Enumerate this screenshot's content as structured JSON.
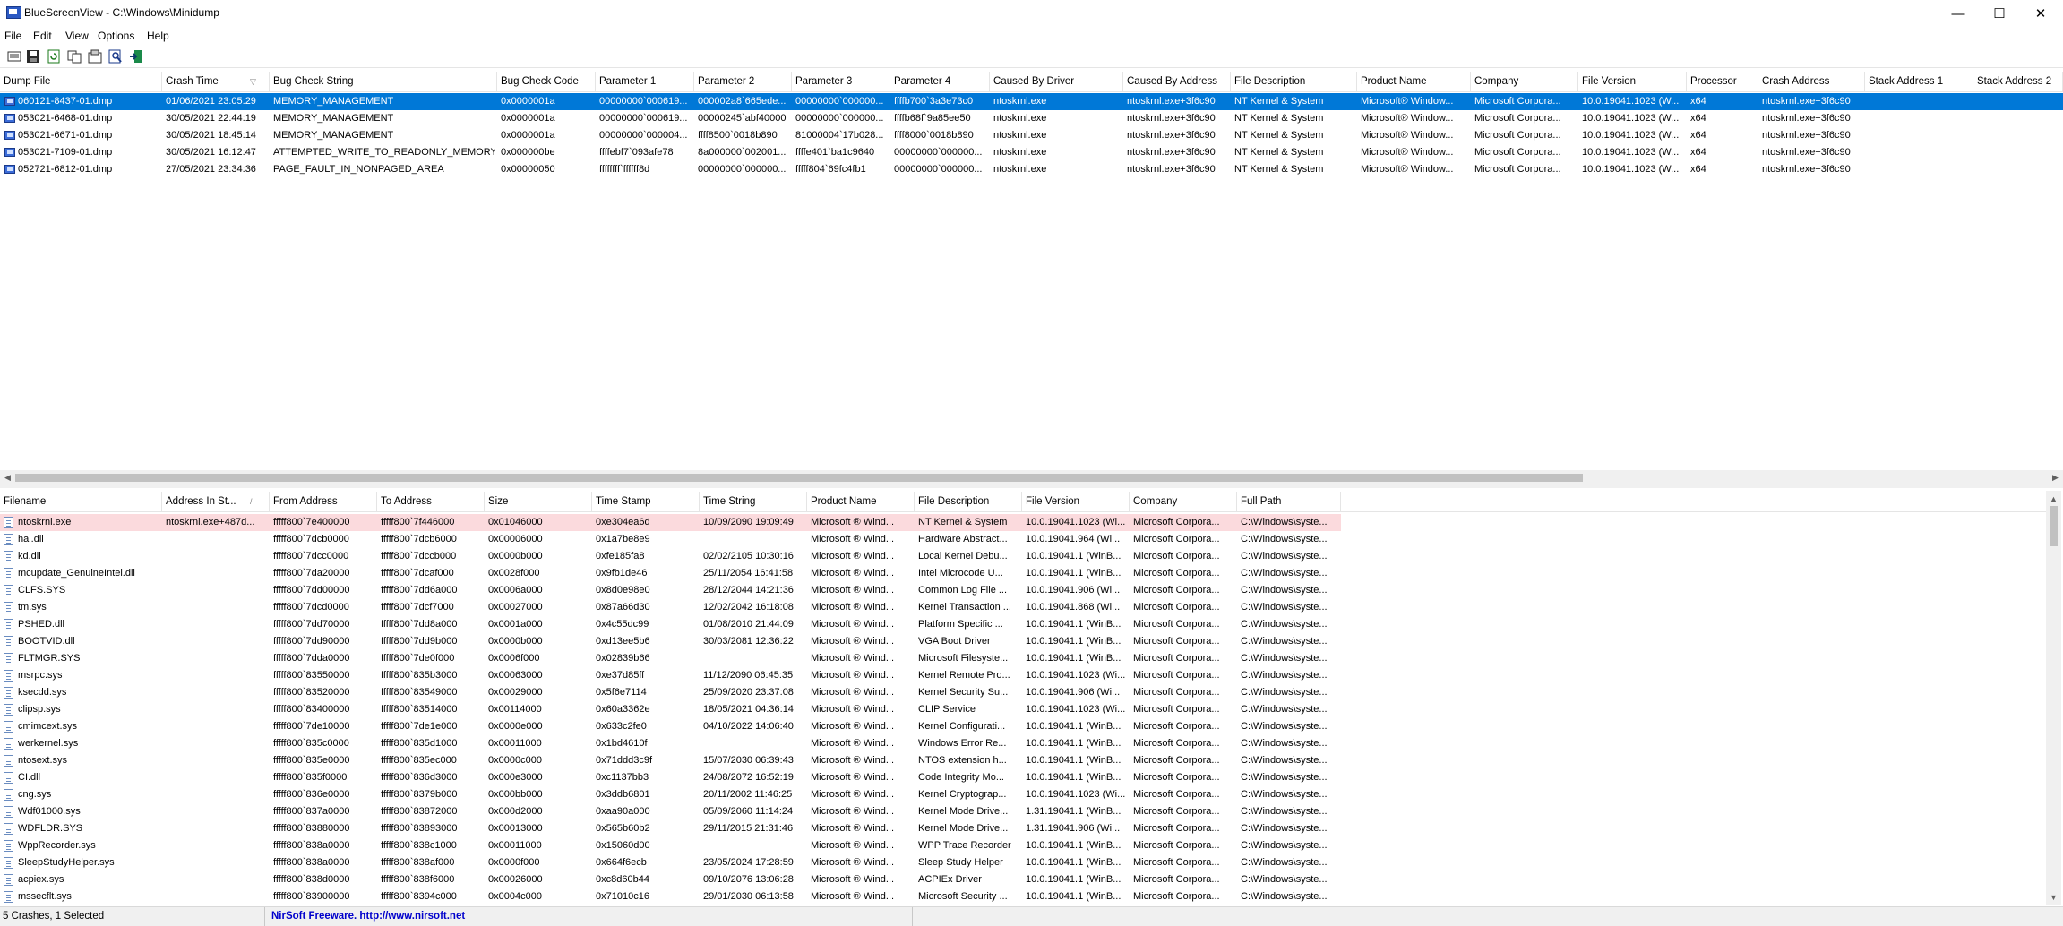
{
  "window": {
    "title": "BlueScreenView  -  C:\\Windows\\Minidump",
    "minimize": "—",
    "maximize": "☐",
    "close": "✕"
  },
  "menu": [
    "File",
    "Edit",
    "View",
    "Options",
    "Help"
  ],
  "toolbar": {
    "icons": [
      "properties-icon",
      "save-icon",
      "refresh-icon",
      "copy-icon",
      "html-report-icon",
      "find-icon",
      "exit-icon"
    ]
  },
  "top_table": {
    "sort_indicator": "▽",
    "columns": [
      "Dump File",
      "Crash Time",
      "Bug Check String",
      "Bug Check Code",
      "Parameter 1",
      "Parameter 2",
      "Parameter 3",
      "Parameter 4",
      "Caused By Driver",
      "Caused By Address",
      "File Description",
      "Product Name",
      "Company",
      "File Version",
      "Processor",
      "Crash Address",
      "Stack Address 1",
      "Stack Address 2"
    ],
    "rows": [
      [
        "060121-8437-01.dmp",
        "01/06/2021 23:05:29",
        "MEMORY_MANAGEMENT",
        "0x0000001a",
        "00000000`000619...",
        "000002a8`665ede...",
        "00000000`000000...",
        "ffffb700`3a3e73c0",
        "ntoskrnl.exe",
        "ntoskrnl.exe+3f6c90",
        "NT Kernel & System",
        "Microsoft® Window...",
        "Microsoft Corpora...",
        "10.0.19041.1023 (W...",
        "x64",
        "ntoskrnl.exe+3f6c90",
        "",
        ""
      ],
      [
        "053021-6468-01.dmp",
        "30/05/2021 22:44:19",
        "MEMORY_MANAGEMENT",
        "0x0000001a",
        "00000000`000619...",
        "00000245`abf40000",
        "00000000`000000...",
        "ffffb68f`9a85ee50",
        "ntoskrnl.exe",
        "ntoskrnl.exe+3f6c90",
        "NT Kernel & System",
        "Microsoft® Window...",
        "Microsoft Corpora...",
        "10.0.19041.1023 (W...",
        "x64",
        "ntoskrnl.exe+3f6c90",
        "",
        ""
      ],
      [
        "053021-6671-01.dmp",
        "30/05/2021 18:45:14",
        "MEMORY_MANAGEMENT",
        "0x0000001a",
        "00000000`000004...",
        "ffff8500`0018b890",
        "81000004`17b028...",
        "ffff8000`0018b890",
        "ntoskrnl.exe",
        "ntoskrnl.exe+3f6c90",
        "NT Kernel & System",
        "Microsoft® Window...",
        "Microsoft Corpora...",
        "10.0.19041.1023 (W...",
        "x64",
        "ntoskrnl.exe+3f6c90",
        "",
        ""
      ],
      [
        "053021-7109-01.dmp",
        "30/05/2021 16:12:47",
        "ATTEMPTED_WRITE_TO_READONLY_MEMORY",
        "0x000000be",
        "ffffebf7`093afe78",
        "8a000000`002001...",
        "ffffe401`ba1c9640",
        "00000000`000000...",
        "ntoskrnl.exe",
        "ntoskrnl.exe+3f6c90",
        "NT Kernel & System",
        "Microsoft® Window...",
        "Microsoft Corpora...",
        "10.0.19041.1023 (W...",
        "x64",
        "ntoskrnl.exe+3f6c90",
        "",
        ""
      ],
      [
        "052721-6812-01.dmp",
        "27/05/2021 23:34:36",
        "PAGE_FAULT_IN_NONPAGED_AREA",
        "0x00000050",
        "ffffffff`ffffff8d",
        "00000000`000000...",
        "fffff804`69fc4fb1",
        "00000000`000000...",
        "ntoskrnl.exe",
        "ntoskrnl.exe+3f6c90",
        "NT Kernel & System",
        "Microsoft® Window...",
        "Microsoft Corpora...",
        "10.0.19041.1023 (W...",
        "x64",
        "ntoskrnl.exe+3f6c90",
        "",
        ""
      ]
    ]
  },
  "bottom_table": {
    "sort_indicator": "/",
    "columns": [
      "Filename",
      "Address In St...",
      "From Address",
      "To Address",
      "Size",
      "Time Stamp",
      "Time String",
      "Product Name",
      "File Description",
      "File Version",
      "Company",
      "Full Path"
    ],
    "rows": [
      [
        "ntoskrnl.exe",
        "ntoskrnl.exe+487d...",
        "fffff800`7e400000",
        "fffff800`7f446000",
        "0x01046000",
        "0xe304ea6d",
        "10/09/2090 19:09:49",
        "Microsoft ® Wind...",
        "NT Kernel & System",
        "10.0.19041.1023 (Wi...",
        "Microsoft Corpora...",
        "C:\\Windows\\syste..."
      ],
      [
        "hal.dll",
        "",
        "fffff800`7dcb0000",
        "fffff800`7dcb6000",
        "0x00006000",
        "0x1a7be8e9",
        "",
        "Microsoft ® Wind...",
        "Hardware Abstract...",
        "10.0.19041.964 (Wi...",
        "Microsoft Corpora...",
        "C:\\Windows\\syste..."
      ],
      [
        "kd.dll",
        "",
        "fffff800`7dcc0000",
        "fffff800`7dccb000",
        "0x0000b000",
        "0xfe185fa8",
        "02/02/2105 10:30:16",
        "Microsoft ® Wind...",
        "Local Kernel Debu...",
        "10.0.19041.1 (WinB...",
        "Microsoft Corpora...",
        "C:\\Windows\\syste..."
      ],
      [
        "mcupdate_GenuineIntel.dll",
        "",
        "fffff800`7da20000",
        "fffff800`7dcaf000",
        "0x0028f000",
        "0x9fb1de46",
        "25/11/2054 16:41:58",
        "Microsoft ® Wind...",
        "Intel Microcode U...",
        "10.0.19041.1 (WinB...",
        "Microsoft Corpora...",
        "C:\\Windows\\syste..."
      ],
      [
        "CLFS.SYS",
        "",
        "fffff800`7dd00000",
        "fffff800`7dd6a000",
        "0x0006a000",
        "0x8d0e98e0",
        "28/12/2044 14:21:36",
        "Microsoft ® Wind...",
        "Common Log File ...",
        "10.0.19041.906 (Wi...",
        "Microsoft Corpora...",
        "C:\\Windows\\syste..."
      ],
      [
        "tm.sys",
        "",
        "fffff800`7dcd0000",
        "fffff800`7dcf7000",
        "0x00027000",
        "0x87a66d30",
        "12/02/2042 16:18:08",
        "Microsoft ® Wind...",
        "Kernel Transaction ...",
        "10.0.19041.868 (Wi...",
        "Microsoft Corpora...",
        "C:\\Windows\\syste..."
      ],
      [
        "PSHED.dll",
        "",
        "fffff800`7dd70000",
        "fffff800`7dd8a000",
        "0x0001a000",
        "0x4c55dc99",
        "01/08/2010 21:44:09",
        "Microsoft ® Wind...",
        "Platform Specific ...",
        "10.0.19041.1 (WinB...",
        "Microsoft Corpora...",
        "C:\\Windows\\syste..."
      ],
      [
        "BOOTVID.dll",
        "",
        "fffff800`7dd90000",
        "fffff800`7dd9b000",
        "0x0000b000",
        "0xd13ee5b6",
        "30/03/2081 12:36:22",
        "Microsoft ® Wind...",
        "VGA Boot Driver",
        "10.0.19041.1 (WinB...",
        "Microsoft Corpora...",
        "C:\\Windows\\syste..."
      ],
      [
        "FLTMGR.SYS",
        "",
        "fffff800`7dda0000",
        "fffff800`7de0f000",
        "0x0006f000",
        "0x02839b66",
        "",
        "Microsoft ® Wind...",
        "Microsoft Filesyste...",
        "10.0.19041.1 (WinB...",
        "Microsoft Corpora...",
        "C:\\Windows\\syste..."
      ],
      [
        "msrpc.sys",
        "",
        "fffff800`83550000",
        "fffff800`835b3000",
        "0x00063000",
        "0xe37d85ff",
        "11/12/2090 06:45:35",
        "Microsoft ® Wind...",
        "Kernel Remote Pro...",
        "10.0.19041.1023 (Wi...",
        "Microsoft Corpora...",
        "C:\\Windows\\syste..."
      ],
      [
        "ksecdd.sys",
        "",
        "fffff800`83520000",
        "fffff800`83549000",
        "0x00029000",
        "0x5f6e7114",
        "25/09/2020 23:37:08",
        "Microsoft ® Wind...",
        "Kernel Security Su...",
        "10.0.19041.906 (Wi...",
        "Microsoft Corpora...",
        "C:\\Windows\\syste..."
      ],
      [
        "clipsp.sys",
        "",
        "fffff800`83400000",
        "fffff800`83514000",
        "0x00114000",
        "0x60a3362e",
        "18/05/2021 04:36:14",
        "Microsoft ® Wind...",
        "CLIP Service",
        "10.0.19041.1023 (Wi...",
        "Microsoft Corpora...",
        "C:\\Windows\\syste..."
      ],
      [
        "cmimcext.sys",
        "",
        "fffff800`7de10000",
        "fffff800`7de1e000",
        "0x0000e000",
        "0x633c2fe0",
        "04/10/2022 14:06:40",
        "Microsoft ® Wind...",
        "Kernel Configurati...",
        "10.0.19041.1 (WinB...",
        "Microsoft Corpora...",
        "C:\\Windows\\syste..."
      ],
      [
        "werkernel.sys",
        "",
        "fffff800`835c0000",
        "fffff800`835d1000",
        "0x00011000",
        "0x1bd4610f",
        "",
        "Microsoft ® Wind...",
        "Windows Error Re...",
        "10.0.19041.1 (WinB...",
        "Microsoft Corpora...",
        "C:\\Windows\\syste..."
      ],
      [
        "ntosext.sys",
        "",
        "fffff800`835e0000",
        "fffff800`835ec000",
        "0x0000c000",
        "0x71ddd3c9f",
        "15/07/2030 06:39:43",
        "Microsoft ® Wind...",
        "NTOS extension h...",
        "10.0.19041.1 (WinB...",
        "Microsoft Corpora...",
        "C:\\Windows\\syste..."
      ],
      [
        "CI.dll",
        "",
        "fffff800`835f0000",
        "fffff800`836d3000",
        "0x000e3000",
        "0xc1137bb3",
        "24/08/2072 16:52:19",
        "Microsoft ® Wind...",
        "Code Integrity Mo...",
        "10.0.19041.1 (WinB...",
        "Microsoft Corpora...",
        "C:\\Windows\\syste..."
      ],
      [
        "cng.sys",
        "",
        "fffff800`836e0000",
        "fffff800`8379b000",
        "0x000bb000",
        "0x3ddb6801",
        "20/11/2002 11:46:25",
        "Microsoft ® Wind...",
        "Kernel Cryptograp...",
        "10.0.19041.1023 (Wi...",
        "Microsoft Corpora...",
        "C:\\Windows\\syste..."
      ],
      [
        "Wdf01000.sys",
        "",
        "fffff800`837a0000",
        "fffff800`83872000",
        "0x000d2000",
        "0xaa90a000",
        "05/09/2060 11:14:24",
        "Microsoft ® Wind...",
        "Kernel Mode Drive...",
        "1.31.19041.1 (WinB...",
        "Microsoft Corpora...",
        "C:\\Windows\\syste..."
      ],
      [
        "WDFLDR.SYS",
        "",
        "fffff800`83880000",
        "fffff800`83893000",
        "0x00013000",
        "0x565b60b2",
        "29/11/2015 21:31:46",
        "Microsoft ® Wind...",
        "Kernel Mode Drive...",
        "1.31.19041.906 (Wi...",
        "Microsoft Corpora...",
        "C:\\Windows\\syste..."
      ],
      [
        "WppRecorder.sys",
        "",
        "fffff800`838a0000",
        "fffff800`838c1000",
        "0x00011000",
        "0x15060d00",
        "",
        "Microsoft ® Wind...",
        "WPP Trace Recorder",
        "10.0.19041.1 (WinB...",
        "Microsoft Corpora...",
        "C:\\Windows\\syste..."
      ],
      [
        "SleepStudyHelper.sys",
        "",
        "fffff800`838a0000",
        "fffff800`838af000",
        "0x0000f000",
        "0x664f6ecb",
        "23/05/2024 17:28:59",
        "Microsoft ® Wind...",
        "Sleep Study Helper",
        "10.0.19041.1 (WinB...",
        "Microsoft Corpora...",
        "C:\\Windows\\syste..."
      ],
      [
        "acpiex.sys",
        "",
        "fffff800`838d0000",
        "fffff800`838f6000",
        "0x00026000",
        "0xc8d60b44",
        "09/10/2076 13:06:28",
        "Microsoft ® Wind...",
        "ACPIEx Driver",
        "10.0.19041.1 (WinB...",
        "Microsoft Corpora...",
        "C:\\Windows\\syste..."
      ],
      [
        "mssecflt.sys",
        "",
        "fffff800`83900000",
        "fffff800`8394c000",
        "0x0004c000",
        "0x71010c16",
        "29/01/2030 06:13:58",
        "Microsoft ® Wind...",
        "Microsoft Security ...",
        "10.0.19041.1 (WinB...",
        "Microsoft Corpora...",
        "C:\\Windows\\syste..."
      ]
    ]
  },
  "status": {
    "count": "5 Crashes, 1 Selected",
    "credit": "NirSoft Freeware.  http://www.nirsoft.net",
    "credit_color": "#0000cc"
  },
  "colors": {
    "selection": "#0078d7",
    "highlight_row": "#fbdadd"
  }
}
